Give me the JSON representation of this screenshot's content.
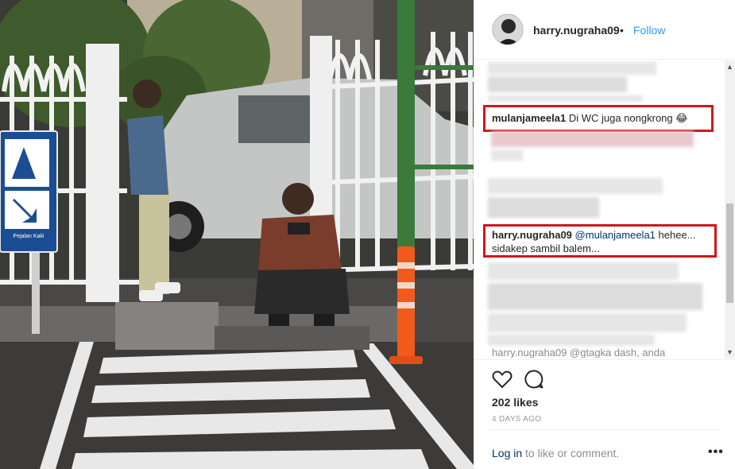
{
  "post": {
    "username": "harry.nugraha09",
    "separator": "•",
    "follow_label": "Follow",
    "likes": "202 likes",
    "time_ago": "4 DAYS AGO"
  },
  "comments": {
    "highlighted_1": {
      "user": "mulanjameela1",
      "text": "Di WC juga nongkrong 😂"
    },
    "highlighted_2": {
      "user": "harry.nugraha09",
      "mention": "@mulanjameela1",
      "text_line1": "hehee...",
      "text_line2": "sidakep sambil balem..."
    },
    "partial_bottom": "harry.nugraha09 @gtagka dash, anda"
  },
  "footer": {
    "login_link": "Log in",
    "login_rest": " to like or comment.",
    "more_label": "•••"
  },
  "photo": {
    "sign_label": "Pejalan Kaki"
  },
  "colors": {
    "highlight": "#d0171c",
    "link": "#3897f0",
    "mention": "#003569"
  },
  "icons": [
    "heart-icon",
    "comment-icon",
    "more-options-icon",
    "scroll-up-icon",
    "scroll-down-icon"
  ]
}
